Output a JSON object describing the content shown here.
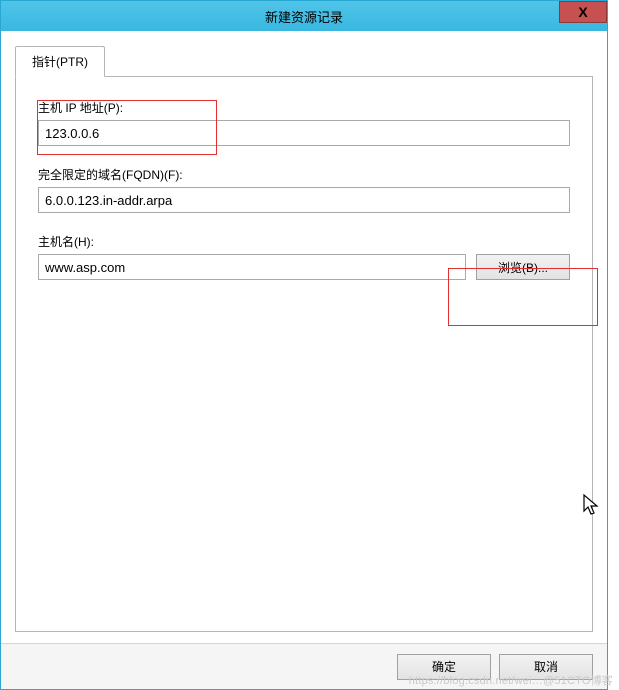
{
  "window": {
    "title": "新建资源记录",
    "close_label": "X"
  },
  "tab": {
    "label": "指针(PTR)"
  },
  "fields": {
    "ip": {
      "label": "主机 IP 地址(P):",
      "value": "123.0.0.6"
    },
    "fqdn": {
      "label": "完全限定的域名(FQDN)(F):",
      "value": "6.0.0.123.in-addr.arpa"
    },
    "hostname": {
      "label": "主机名(H):",
      "value": "www.asp.com",
      "browse_label": "浏览(B)..."
    }
  },
  "footer": {
    "ok": "确定",
    "cancel": "取消"
  },
  "watermark": "https://blog.csdn.net/wei…@51CTO博客"
}
